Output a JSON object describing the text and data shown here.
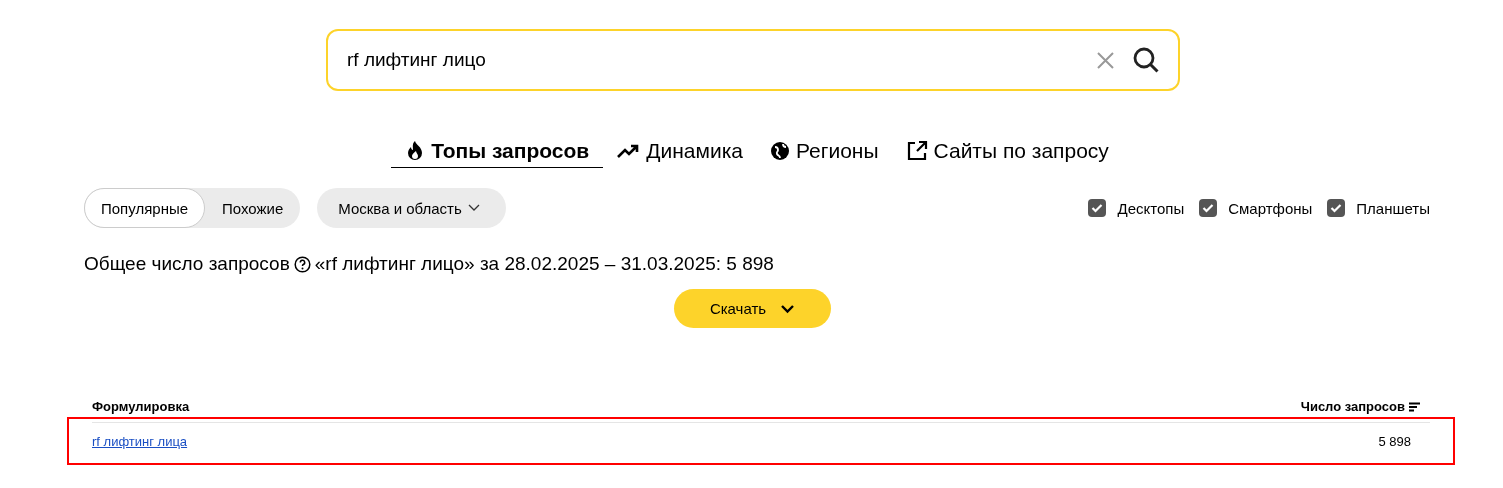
{
  "search": {
    "value": "rf лифтинг лицо"
  },
  "tabs": [
    {
      "label": "Топы запросов",
      "kind": "fire",
      "selected": true
    },
    {
      "label": "Динамика",
      "kind": "trend",
      "selected": false
    },
    {
      "label": "Регионы",
      "kind": "globe",
      "selected": false
    },
    {
      "label": "Сайты по запросу",
      "kind": "external",
      "selected": false
    }
  ],
  "segments": [
    {
      "label": "Популярные",
      "selected": true
    },
    {
      "label": "Похожие",
      "selected": false
    }
  ],
  "region": {
    "label": "Москва и область"
  },
  "devices": [
    {
      "label": "Десктопы",
      "checked": true
    },
    {
      "label": "Смартфоны",
      "checked": true
    },
    {
      "label": "Планшеты",
      "checked": true
    }
  ],
  "summary": {
    "label": "Общее число запросов",
    "details": "«rf лифтинг лицо» за 28.02.2025 – 31.03.2025: 5 898"
  },
  "download": {
    "label": "Скачать"
  },
  "table": {
    "columns": [
      "Формулировка",
      "Число запросов"
    ],
    "rows": [
      {
        "phrase": "rf лифтинг лица",
        "count": "5 898",
        "highlighted": true
      }
    ]
  }
}
